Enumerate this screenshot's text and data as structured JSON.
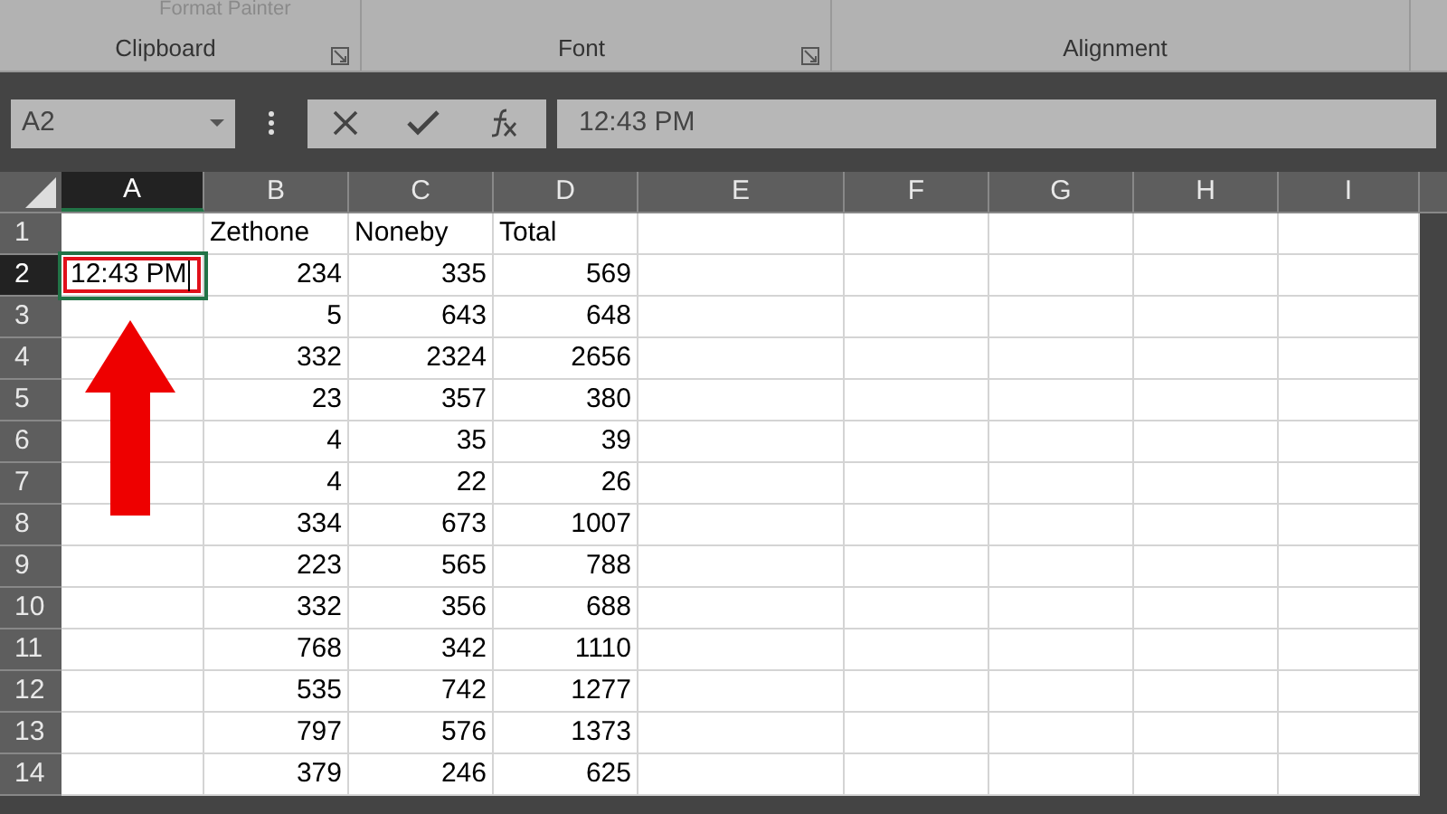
{
  "ribbon": {
    "format_painter": "Format Painter",
    "groups": [
      {
        "label": "Clipboard",
        "launcher": true
      },
      {
        "label": "Font",
        "launcher": true
      },
      {
        "label": "Alignment",
        "launcher": false
      }
    ]
  },
  "formula_bar": {
    "name_box": "A2",
    "formula": "12:43 PM"
  },
  "sheet": {
    "columns": [
      {
        "label": "A",
        "selected": true
      },
      {
        "label": "B",
        "selected": false
      },
      {
        "label": "C",
        "selected": false
      },
      {
        "label": "D",
        "selected": false
      },
      {
        "label": "E",
        "selected": false
      },
      {
        "label": "F",
        "selected": false
      },
      {
        "label": "G",
        "selected": false
      },
      {
        "label": "H",
        "selected": false
      },
      {
        "label": "I",
        "selected": false
      }
    ],
    "rows": [
      {
        "label": "1",
        "selected": false,
        "kind": "text",
        "cells": [
          null,
          "Zethone",
          "Noneby",
          "Total"
        ]
      },
      {
        "label": "2",
        "selected": true,
        "kind": "number",
        "cells": [
          "12:43 PM",
          "234",
          "335",
          "569"
        ]
      },
      {
        "label": "3",
        "selected": false,
        "kind": "number",
        "cells": [
          null,
          "5",
          "643",
          "648"
        ]
      },
      {
        "label": "4",
        "selected": false,
        "kind": "number",
        "cells": [
          null,
          "332",
          "2324",
          "2656"
        ]
      },
      {
        "label": "5",
        "selected": false,
        "kind": "number",
        "cells": [
          null,
          "23",
          "357",
          "380"
        ]
      },
      {
        "label": "6",
        "selected": false,
        "kind": "number",
        "cells": [
          null,
          "4",
          "35",
          "39"
        ]
      },
      {
        "label": "7",
        "selected": false,
        "kind": "number",
        "cells": [
          null,
          "4",
          "22",
          "26"
        ]
      },
      {
        "label": "8",
        "selected": false,
        "kind": "number",
        "cells": [
          null,
          "334",
          "673",
          "1007"
        ]
      },
      {
        "label": "9",
        "selected": false,
        "kind": "number",
        "cells": [
          null,
          "223",
          "565",
          "788"
        ]
      },
      {
        "label": "10",
        "selected": false,
        "kind": "number",
        "cells": [
          null,
          "332",
          "356",
          "688"
        ]
      },
      {
        "label": "11",
        "selected": false,
        "kind": "number",
        "cells": [
          null,
          "768",
          "342",
          "1110"
        ]
      },
      {
        "label": "12",
        "selected": false,
        "kind": "number",
        "cells": [
          null,
          "535",
          "742",
          "1277"
        ]
      },
      {
        "label": "13",
        "selected": false,
        "kind": "number",
        "cells": [
          null,
          "797",
          "576",
          "1373"
        ]
      },
      {
        "label": "14",
        "selected": false,
        "kind": "number",
        "cells": [
          null,
          "379",
          "246",
          "625"
        ]
      }
    ]
  }
}
